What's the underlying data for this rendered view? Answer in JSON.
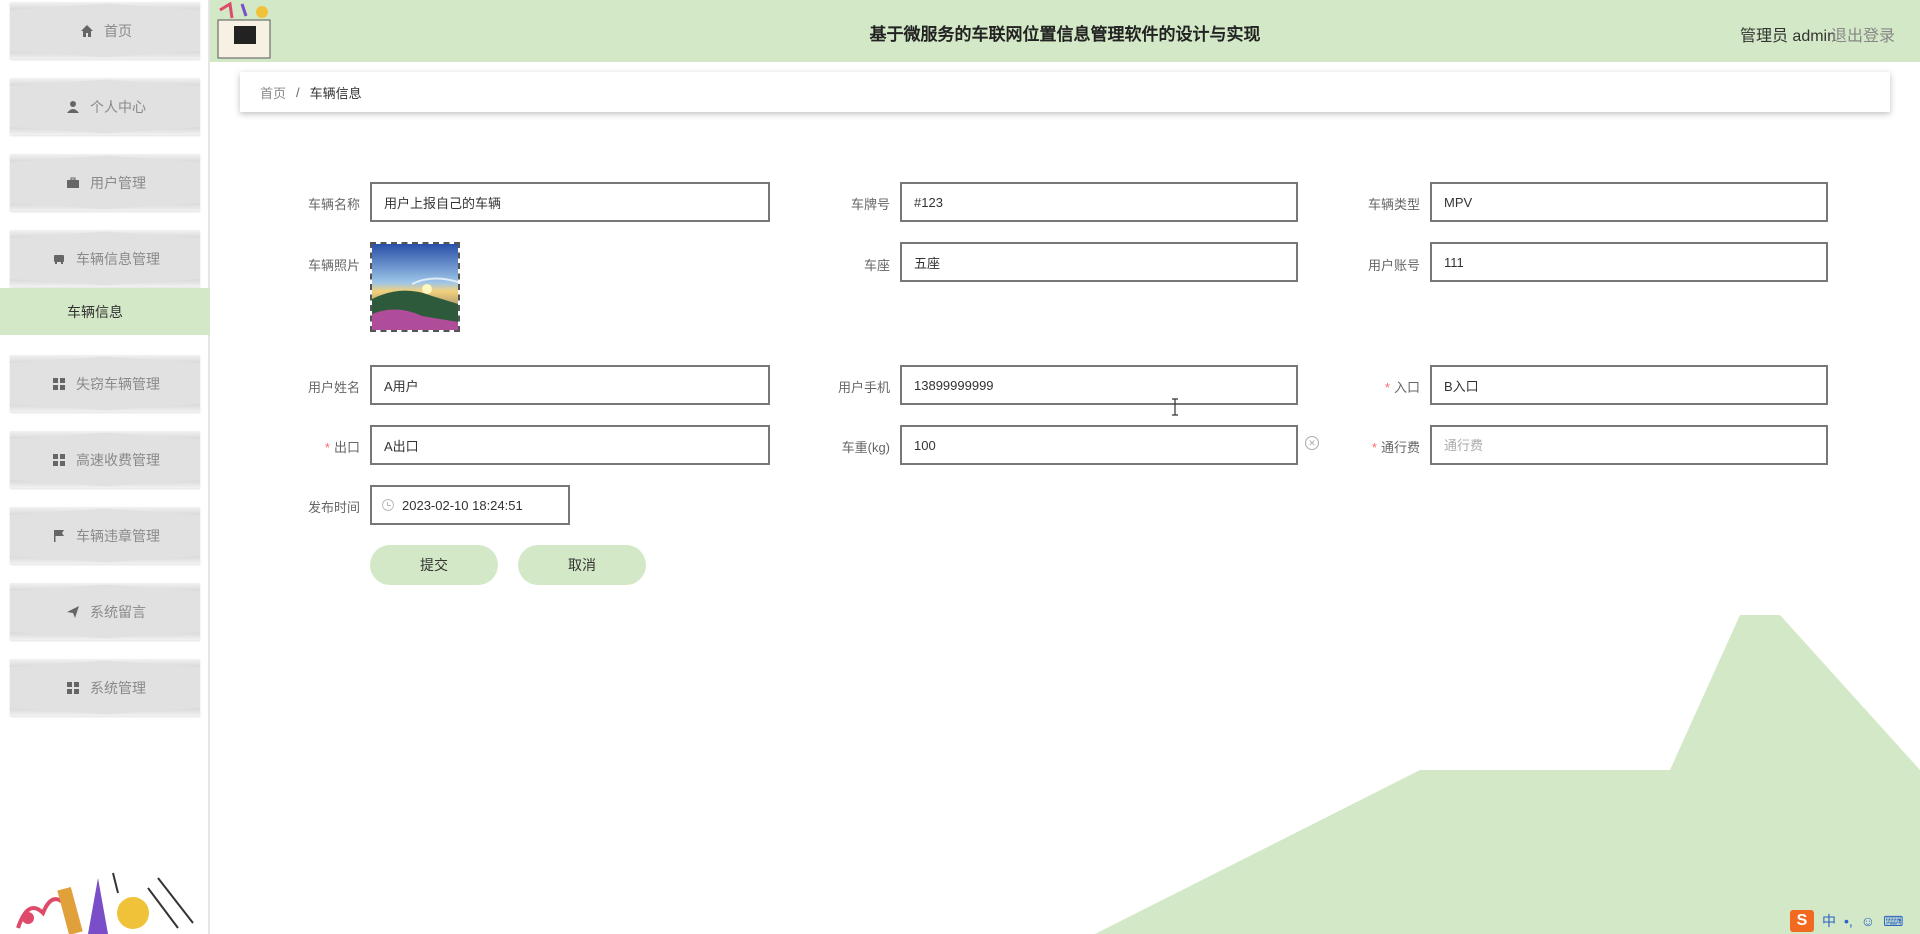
{
  "header": {
    "title": "基于微服务的车联网位置信息管理软件的设计与实现",
    "user_label": "管理员 admin",
    "logout_label": "退出登录"
  },
  "sidebar": {
    "items": [
      {
        "label": "首页",
        "icon": "home-icon"
      },
      {
        "label": "个人中心",
        "icon": "user-icon"
      },
      {
        "label": "用户管理",
        "icon": "briefcase-icon"
      },
      {
        "label": "车辆信息管理",
        "icon": "car-icon"
      },
      {
        "label": "失窃车辆管理",
        "icon": "grid-icon"
      },
      {
        "label": "高速收费管理",
        "icon": "grid-icon"
      },
      {
        "label": "车辆违章管理",
        "icon": "flag-icon"
      },
      {
        "label": "系统留言",
        "icon": "send-icon"
      },
      {
        "label": "系统管理",
        "icon": "grid-icon"
      }
    ],
    "submenu_active": "车辆信息"
  },
  "breadcrumb": {
    "home": "首页",
    "separator": "/",
    "current": "车辆信息"
  },
  "form": {
    "vehicle_name": {
      "label": "车辆名称",
      "value": "用户上报自己的车辆"
    },
    "plate_no": {
      "label": "车牌号",
      "value": "#123"
    },
    "vehicle_type": {
      "label": "车辆类型",
      "value": "MPV"
    },
    "photo": {
      "label": "车辆照片"
    },
    "seats": {
      "label": "车座",
      "value": "五座"
    },
    "user_account": {
      "label": "用户账号",
      "value": "111"
    },
    "user_name": {
      "label": "用户姓名",
      "value": "A用户"
    },
    "user_phone": {
      "label": "用户手机",
      "value": "13899999999"
    },
    "entrance": {
      "label": "入口",
      "value": "B入口",
      "required": "*"
    },
    "exit": {
      "label": "出口",
      "value": "A出口",
      "required": "*"
    },
    "weight": {
      "label": "车重(kg)",
      "value": "100"
    },
    "toll": {
      "label": "通行费",
      "value": "",
      "placeholder": "通行费",
      "required": "*"
    },
    "publish_time": {
      "label": "发布时间",
      "value": "2023-02-10 18:24:51"
    }
  },
  "buttons": {
    "submit": "提交",
    "cancel": "取消"
  },
  "ime": {
    "logo": "S",
    "mode": "中",
    "punct": "•,"
  },
  "colors": {
    "accent_green": "#d3e8c6",
    "menu_gray": "#e1e1e1",
    "required_red": "#f56c6c"
  }
}
